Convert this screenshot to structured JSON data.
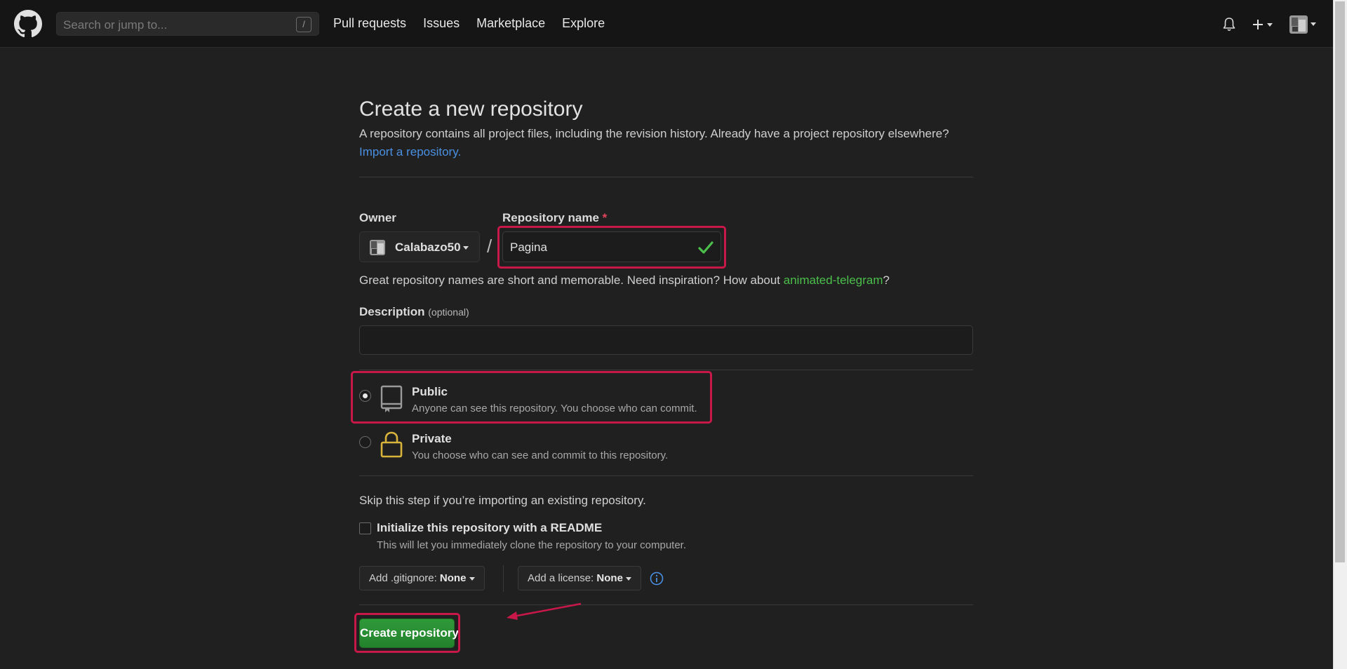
{
  "header": {
    "search_placeholder": "Search or jump to...",
    "search_key": "/",
    "nav": [
      "Pull requests",
      "Issues",
      "Marketplace",
      "Explore"
    ]
  },
  "page": {
    "title": "Create a new repository",
    "subtitle": "A repository contains all project files, including the revision history. Already have a project repository elsewhere?",
    "import_link": "Import a repository."
  },
  "form": {
    "owner_label": "Owner",
    "owner_name": "Calabazo50",
    "slash": "/",
    "repo_name_label": "Repository name",
    "required_mark": "*",
    "repo_name_value": "Pagina",
    "hint_prefix": "Great repository names are short and memorable. Need inspiration? How about ",
    "hint_suggestion": "animated-telegram",
    "hint_suffix": "?",
    "description_label": "Description",
    "description_optional": "(optional)",
    "description_value": "",
    "visibility": [
      {
        "title": "Public",
        "desc": "Anyone can see this repository. You choose who can commit.",
        "selected": true
      },
      {
        "title": "Private",
        "desc": "You choose who can see and commit to this repository.",
        "selected": false
      }
    ],
    "skip_text": "Skip this step if you’re importing an existing repository.",
    "init_title": "Initialize this repository with a README",
    "init_desc": "This will let you immediately clone the repository to your computer.",
    "gitignore_label": "Add .gitignore:",
    "gitignore_value": "None",
    "license_label": "Add a license:",
    "license_value": "None",
    "create_button": "Create repository"
  },
  "colors": {
    "accent_link": "#4a90e2",
    "success": "#4bbf4b",
    "highlight": "#c8184a",
    "lock": "#d9b43a",
    "create_button": "#2c9136"
  }
}
